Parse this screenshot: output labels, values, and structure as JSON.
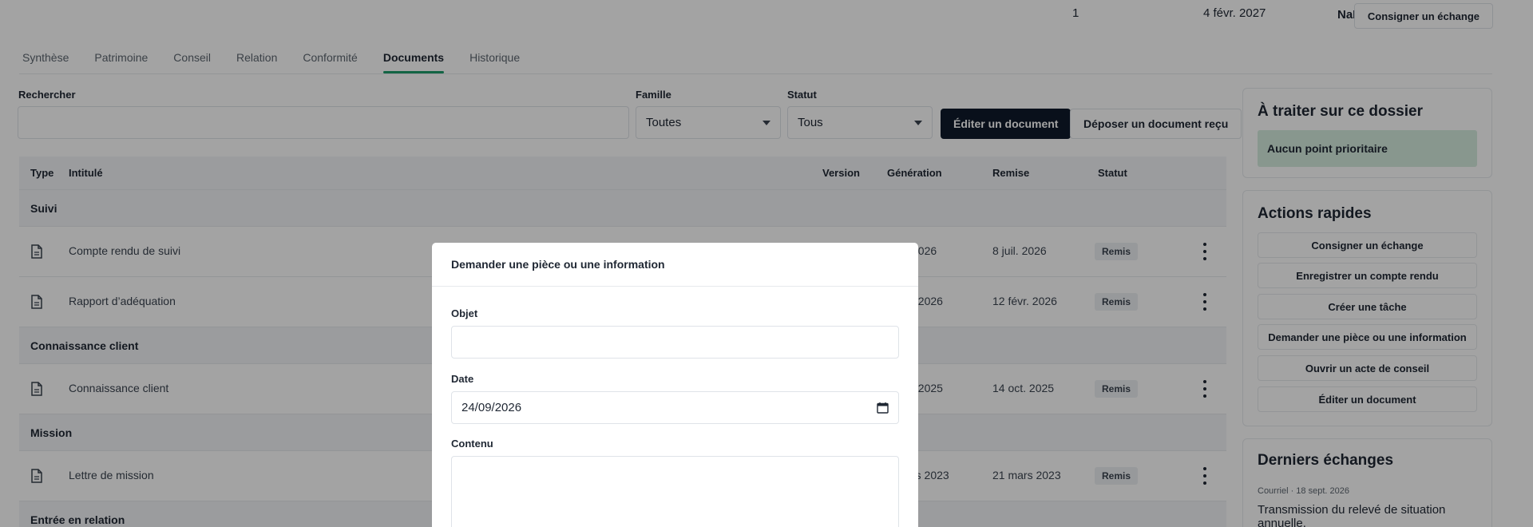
{
  "top": {
    "count": "1",
    "date": "4 févr. 2027",
    "delay": "NaN j",
    "log_exchange_button": "Consigner un échange"
  },
  "tabs": [
    {
      "label": "Synthèse"
    },
    {
      "label": "Patrimoine"
    },
    {
      "label": "Conseil"
    },
    {
      "label": "Relation"
    },
    {
      "label": "Conformité"
    },
    {
      "label": "Documents"
    },
    {
      "label": "Historique"
    }
  ],
  "filters": {
    "search_label": "Rechercher",
    "search_value": "",
    "family_label": "Famille",
    "family_value": "Toutes",
    "status_label": "Statut",
    "status_value": "Tous",
    "edit_button": "Éditer un document",
    "upload_button": "Déposer un document reçu"
  },
  "table": {
    "headers": {
      "type": "Type",
      "title": "Intitulé",
      "version": "Version",
      "generation": "Génération",
      "delivery": "Remise",
      "status": "Statut"
    },
    "groups": [
      {
        "name": "Suivi",
        "rows": [
          {
            "title": "Compte rendu de suivi",
            "generation": "2026",
            "delivery": "8 juil. 2026",
            "status": "Remis"
          },
          {
            "title": "Rapport d’adéquation",
            "generation": ". 2026",
            "delivery": "12 févr. 2026",
            "status": "Remis"
          }
        ]
      },
      {
        "name": "Connaissance client",
        "rows": [
          {
            "title": "Connaissance client",
            "generation": ". 2025",
            "delivery": "14 oct. 2025",
            "status": "Remis"
          }
        ]
      },
      {
        "name": "Mission",
        "rows": [
          {
            "title": "Lettre de mission",
            "generation": "rs 2023",
            "delivery": "21 mars 2023",
            "status": "Remis"
          }
        ]
      },
      {
        "name": "Entrée en relation",
        "rows": []
      }
    ]
  },
  "panel": {
    "todo_title": "À traiter sur ce dossier",
    "todo_empty": "Aucun point prioritaire",
    "actions_title": "Actions rapides",
    "actions": [
      "Consigner un échange",
      "Enregistrer un compte rendu",
      "Créer une tâche",
      "Demander une pièce ou une information",
      "Ouvrir un acte de conseil",
      "Éditer un document"
    ],
    "exchanges_title": "Derniers échanges",
    "exchange_meta": "Courriel · 18 sept. 2026",
    "exchange_text": "Transmission du relevé de situation annuelle."
  },
  "modal": {
    "title": "Demander une pièce ou une information",
    "subject_label": "Objet",
    "subject_value": "",
    "date_label": "Date",
    "date_value": "24/09/2026",
    "content_label": "Contenu",
    "content_value": ""
  },
  "colors": {
    "accent": "#1f9d6b",
    "primary_button": "#0f1a2b",
    "priority_bg": "#d5ecdf",
    "overlay": "rgba(0,0,0,0.36)"
  }
}
